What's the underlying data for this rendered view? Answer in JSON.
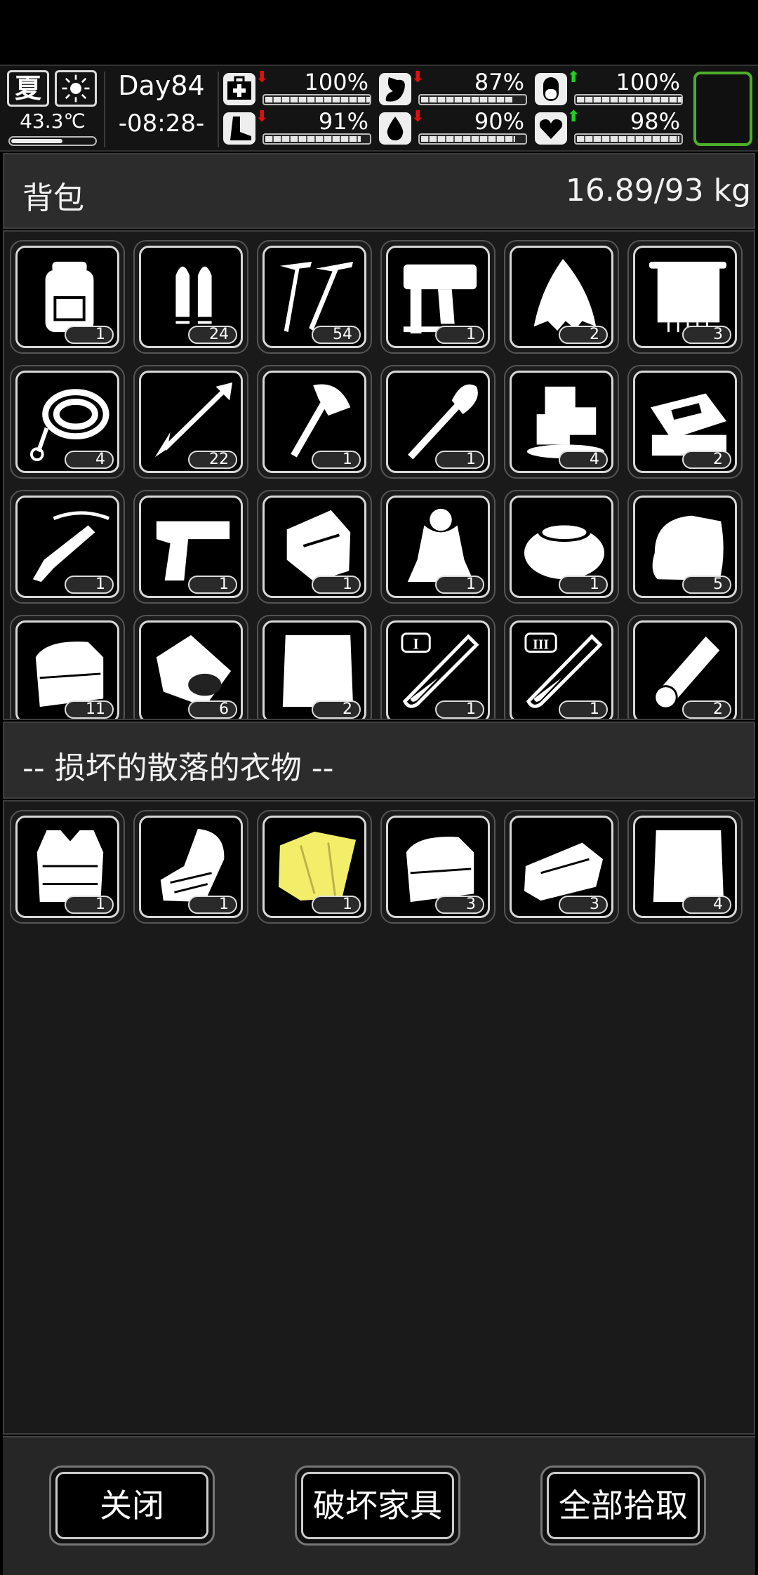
{
  "status": {
    "season": "夏",
    "weather_icon": "sun-icon",
    "temperature": "43.3℃",
    "day": "Day84",
    "time": "-08:28-",
    "stats": [
      {
        "name": "health",
        "icon": "medkit-icon",
        "trend": "down",
        "trend_color": "#e01010",
        "value": "100%",
        "fraction": 1.0
      },
      {
        "name": "hunger",
        "icon": "stomach-icon",
        "trend": "down",
        "trend_color": "#e01010",
        "value": "87%",
        "fraction": 0.87
      },
      {
        "name": "mood",
        "icon": "pill-icon",
        "trend": "up",
        "trend_color": "#20d020",
        "value": "100%",
        "fraction": 1.0
      },
      {
        "name": "stamina",
        "icon": "foot-icon",
        "trend": "down",
        "trend_color": "#e01010",
        "value": "91%",
        "fraction": 0.91
      },
      {
        "name": "thirst",
        "icon": "water-drop-icon",
        "trend": "down",
        "trend_color": "#e01010",
        "value": "90%",
        "fraction": 0.9
      },
      {
        "name": "vitality",
        "icon": "heart-icon",
        "trend": "up",
        "trend_color": "#20d020",
        "value": "98%",
        "fraction": 0.98
      }
    ]
  },
  "backpack": {
    "title": "背包",
    "weight": "16.89/93 kg",
    "items": [
      {
        "icon": "backpack-icon",
        "count": "1"
      },
      {
        "icon": "bullets-icon",
        "count": "24"
      },
      {
        "icon": "nails-icon",
        "count": "54"
      },
      {
        "icon": "nail-gun-icon",
        "count": "1"
      },
      {
        "icon": "cloth-scrap-icon",
        "count": "2"
      },
      {
        "icon": "towel-icon",
        "count": "3"
      },
      {
        "icon": "rope-icon",
        "count": "4"
      },
      {
        "icon": "arrow-icon",
        "count": "22"
      },
      {
        "icon": "hatchet-icon",
        "count": "1"
      },
      {
        "icon": "shovel-icon",
        "count": "1"
      },
      {
        "icon": "ice-icon",
        "count": "4"
      },
      {
        "icon": "toolbox-icon",
        "count": "2"
      },
      {
        "icon": "crossbow-icon",
        "count": "1"
      },
      {
        "icon": "pistol-icon",
        "count": "1"
      },
      {
        "icon": "gloves-icon",
        "count": "1"
      },
      {
        "icon": "cloak-icon",
        "count": "1"
      },
      {
        "icon": "fur-collar-icon",
        "count": "1"
      },
      {
        "icon": "folded-cloth-icon",
        "count": "5"
      },
      {
        "icon": "folded-clothes-icon",
        "count": "11"
      },
      {
        "icon": "food-bag-icon",
        "count": "6"
      },
      {
        "icon": "paper-sheet-icon",
        "count": "2"
      },
      {
        "icon": "test-tube-1-icon",
        "count": "1"
      },
      {
        "icon": "test-tube-3-icon",
        "count": "1"
      },
      {
        "icon": "bandage-roll-icon",
        "count": "2"
      }
    ]
  },
  "container": {
    "title": "-- 损坏的散落的衣物 --",
    "items": [
      {
        "icon": "vest-icon",
        "count": "1"
      },
      {
        "icon": "gauntlet-icon",
        "count": "1"
      },
      {
        "icon": "yellow-raincoat-icon",
        "count": "1",
        "color": "#f2ee6a"
      },
      {
        "icon": "folded-clothes-icon",
        "count": "3"
      },
      {
        "icon": "rags-icon",
        "count": "3"
      },
      {
        "icon": "paper-sheet-icon",
        "count": "4"
      }
    ]
  },
  "buttons": {
    "close": "关闭",
    "destroy": "破坏家具",
    "pickup_all": "全部拾取"
  }
}
